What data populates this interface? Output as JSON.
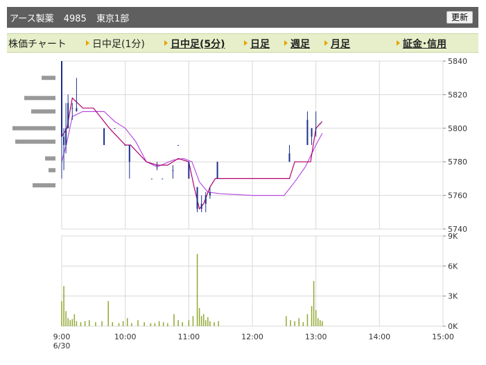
{
  "header": {
    "company": "アース製薬",
    "code": "4985",
    "market": "東京1部",
    "refresh_label": "更新"
  },
  "tabs": [
    {
      "label": "株価チャート",
      "active": false,
      "arrow": false,
      "link": false
    },
    {
      "label": "日中足(1分)",
      "active": false,
      "arrow": true,
      "link": false
    },
    {
      "label": "日中足(5分)",
      "active": true,
      "arrow": true,
      "link": true
    },
    {
      "label": "日足",
      "active": false,
      "arrow": true,
      "link": true
    },
    {
      "label": "週足",
      "active": false,
      "arrow": true,
      "link": true
    },
    {
      "label": "月足",
      "active": false,
      "arrow": true,
      "link": true
    },
    {
      "label": "証金･信用",
      "active": false,
      "arrow": true,
      "link": true
    }
  ],
  "chart_data": {
    "type": "candlestick-intraday",
    "x_axis": {
      "tick_labels": [
        "9:00",
        "10:00",
        "11:00",
        "12:00",
        "13:00",
        "14:00",
        "15:00"
      ],
      "date_label": "6/30",
      "range": [
        "9:00",
        "15:00"
      ]
    },
    "price_axis": {
      "ticks": [
        5740,
        5760,
        5780,
        5800,
        5820,
        5840
      ],
      "range": [
        5740,
        5840
      ]
    },
    "volume_axis": {
      "ticks": [
        "0K",
        "3K",
        "6K",
        "9K"
      ],
      "range": [
        0,
        9000
      ]
    },
    "grid": true,
    "colors": {
      "candle": "#1a2f8c",
      "ma_short": "#b0006e",
      "ma_long": "#b84de0",
      "volume": "#8fa830",
      "profile": "#999999",
      "grid": "#d8d8d8"
    },
    "candles": [
      {
        "t": "9:00",
        "o": 5840,
        "h": 5840,
        "l": 5770,
        "c": 5795
      },
      {
        "t": "9:02",
        "o": 5795,
        "h": 5800,
        "l": 5775,
        "c": 5790
      },
      {
        "t": "9:04",
        "o": 5790,
        "h": 5815,
        "l": 5785,
        "c": 5800
      },
      {
        "t": "9:06",
        "o": 5800,
        "h": 5820,
        "l": 5800,
        "c": 5815
      },
      {
        "t": "9:10",
        "o": 5812,
        "h": 5815,
        "l": 5805,
        "c": 5812
      },
      {
        "t": "9:14",
        "o": 5812,
        "h": 5830,
        "l": 5810,
        "c": 5810
      },
      {
        "t": "9:40",
        "o": 5800,
        "h": 5800,
        "l": 5790,
        "c": 5790
      },
      {
        "t": "9:50",
        "o": 5800,
        "h": 5800,
        "l": 5800,
        "c": 5800
      },
      {
        "t": "10:00",
        "o": 5790,
        "h": 5790,
        "l": 5790,
        "c": 5790
      },
      {
        "t": "10:04",
        "o": 5790,
        "h": 5790,
        "l": 5770,
        "c": 5780
      },
      {
        "t": "10:25",
        "o": 5770,
        "h": 5770,
        "l": 5770,
        "c": 5770
      },
      {
        "t": "10:30",
        "o": 5778,
        "h": 5780,
        "l": 5775,
        "c": 5778
      },
      {
        "t": "10:35",
        "o": 5770,
        "h": 5770,
        "l": 5770,
        "c": 5770
      },
      {
        "t": "10:45",
        "o": 5775,
        "h": 5778,
        "l": 5770,
        "c": 5775
      },
      {
        "t": "10:50",
        "o": 5790,
        "h": 5790,
        "l": 5790,
        "c": 5790
      },
      {
        "t": "11:00",
        "o": 5780,
        "h": 5780,
        "l": 5770,
        "c": 5770
      },
      {
        "t": "11:08",
        "o": 5765,
        "h": 5765,
        "l": 5750,
        "c": 5752
      },
      {
        "t": "11:12",
        "o": 5752,
        "h": 5760,
        "l": 5750,
        "c": 5755
      },
      {
        "t": "11:16",
        "o": 5755,
        "h": 5762,
        "l": 5750,
        "c": 5760
      },
      {
        "t": "11:20",
        "o": 5760,
        "h": 5765,
        "l": 5758,
        "c": 5762
      },
      {
        "t": "11:27",
        "o": 5770,
        "h": 5780,
        "l": 5770,
        "c": 5780
      },
      {
        "t": "12:35",
        "o": 5780,
        "h": 5790,
        "l": 5780,
        "c": 5785
      },
      {
        "t": "12:52",
        "o": 5790,
        "h": 5810,
        "l": 5790,
        "c": 5805
      },
      {
        "t": "12:56",
        "o": 5800,
        "h": 5800,
        "l": 5790,
        "c": 5795
      },
      {
        "t": "13:00",
        "o": 5800,
        "h": 5810,
        "l": 5795,
        "c": 5800
      },
      {
        "t": "13:04",
        "o": 5803,
        "h": 5803,
        "l": 5803,
        "c": 5803
      }
    ],
    "ma_short": [
      [
        "9:00",
        5795
      ],
      [
        "9:05",
        5800
      ],
      [
        "9:10",
        5818
      ],
      [
        "9:20",
        5812
      ],
      [
        "9:30",
        5812
      ],
      [
        "9:45",
        5800
      ],
      [
        "10:00",
        5790
      ],
      [
        "10:05",
        5790
      ],
      [
        "10:20",
        5780
      ],
      [
        "10:30",
        5778
      ],
      [
        "10:40",
        5778
      ],
      [
        "10:50",
        5782
      ],
      [
        "11:00",
        5780
      ],
      [
        "11:05",
        5765
      ],
      [
        "11:10",
        5752
      ],
      [
        "11:14",
        5755
      ],
      [
        "11:20",
        5765
      ],
      [
        "11:25",
        5770
      ],
      [
        "12:35",
        5770
      ],
      [
        "12:40",
        5780
      ],
      [
        "12:55",
        5780
      ],
      [
        "13:00",
        5800
      ],
      [
        "13:06",
        5804
      ]
    ],
    "ma_long": [
      [
        "9:00",
        5780
      ],
      [
        "9:05",
        5792
      ],
      [
        "9:10",
        5807
      ],
      [
        "9:20",
        5810
      ],
      [
        "9:40",
        5810
      ],
      [
        "9:50",
        5804
      ],
      [
        "10:00",
        5800
      ],
      [
        "10:10",
        5792
      ],
      [
        "10:20",
        5780
      ],
      [
        "10:30",
        5777
      ],
      [
        "10:45",
        5781
      ],
      [
        "10:55",
        5782
      ],
      [
        "11:03",
        5780
      ],
      [
        "11:10",
        5768
      ],
      [
        "11:18",
        5762
      ],
      [
        "11:30",
        5761
      ],
      [
        "12:00",
        5760
      ],
      [
        "12:30",
        5760
      ],
      [
        "12:40",
        5768
      ],
      [
        "12:50",
        5777
      ],
      [
        "13:00",
        5790
      ],
      [
        "13:06",
        5797
      ]
    ],
    "volume": [
      [
        "9:00",
        2500
      ],
      [
        "9:02",
        4000
      ],
      [
        "9:04",
        1500
      ],
      [
        "9:06",
        800
      ],
      [
        "9:08",
        600
      ],
      [
        "9:10",
        700
      ],
      [
        "9:12",
        1200
      ],
      [
        "9:14",
        500
      ],
      [
        "9:18",
        400
      ],
      [
        "9:22",
        500
      ],
      [
        "9:26",
        600
      ],
      [
        "9:32",
        400
      ],
      [
        "9:38",
        500
      ],
      [
        "9:44",
        2500
      ],
      [
        "9:48",
        400
      ],
      [
        "9:54",
        300
      ],
      [
        "9:58",
        500
      ],
      [
        "10:02",
        800
      ],
      [
        "10:06",
        300
      ],
      [
        "10:12",
        600
      ],
      [
        "10:18",
        400
      ],
      [
        "10:24",
        300
      ],
      [
        "10:28",
        300
      ],
      [
        "10:32",
        500
      ],
      [
        "10:36",
        400
      ],
      [
        "10:40",
        300
      ],
      [
        "10:46",
        1200
      ],
      [
        "10:50",
        600
      ],
      [
        "10:54",
        400
      ],
      [
        "11:00",
        600
      ],
      [
        "11:04",
        1000
      ],
      [
        "11:08",
        7200
      ],
      [
        "11:10",
        1800
      ],
      [
        "11:12",
        1000
      ],
      [
        "11:14",
        1200
      ],
      [
        "11:16",
        600
      ],
      [
        "11:18",
        900
      ],
      [
        "11:20",
        500
      ],
      [
        "11:24",
        400
      ],
      [
        "11:28",
        500
      ],
      [
        "12:32",
        1000
      ],
      [
        "12:36",
        600
      ],
      [
        "12:40",
        500
      ],
      [
        "12:44",
        800
      ],
      [
        "12:48",
        400
      ],
      [
        "12:52",
        1200
      ],
      [
        "12:56",
        2000
      ],
      [
        "12:58",
        4500
      ],
      [
        "13:00",
        1600
      ],
      [
        "13:02",
        800
      ],
      [
        "13:04",
        600
      ],
      [
        "13:06",
        500
      ]
    ],
    "price_profile": [
      [
        5830,
        20
      ],
      [
        5818,
        45
      ],
      [
        5810,
        35
      ],
      [
        5800,
        62
      ],
      [
        5792,
        58
      ],
      [
        5782,
        15
      ],
      [
        5775,
        10
      ],
      [
        5766,
        33
      ]
    ]
  }
}
